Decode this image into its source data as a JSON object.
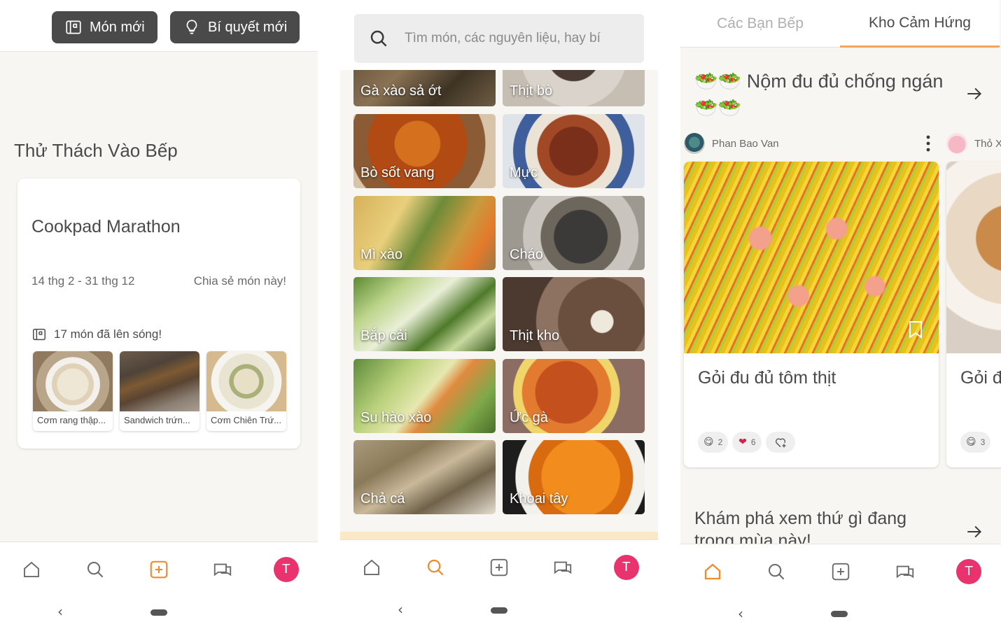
{
  "screen1": {
    "buttons": {
      "new_recipe": "Món mới",
      "new_tip": "Bí quyết mới"
    },
    "section_title": "Thử Thách Vào Bếp",
    "challenge": {
      "title": "Cookpad Marathon",
      "date_range": "14 thg 2 - 31 thg 12",
      "share_label": "Chia sẻ món này!",
      "count_label": "17 món đã lên sóng!",
      "thumbnails": [
        {
          "caption": "Cơm rang thập..."
        },
        {
          "caption": "Sandwich trứn..."
        },
        {
          "caption": "Cơm Chiên Trứ..."
        }
      ]
    }
  },
  "screen2": {
    "search": {
      "placeholder": "Tìm món, các nguyên liệu, hay bí"
    },
    "tiles": [
      {
        "label": "Gà xào sả ớt"
      },
      {
        "label": "Thịt bò"
      },
      {
        "label": "Bò sốt vang"
      },
      {
        "label": "Mực"
      },
      {
        "label": "Mì xào"
      },
      {
        "label": "Cháo"
      },
      {
        "label": "Bắp cải"
      },
      {
        "label": "Thịt kho"
      },
      {
        "label": "Su hào xào"
      },
      {
        "label": "Ức gà"
      },
      {
        "label": "Chả cá"
      },
      {
        "label": "Khoai tây"
      }
    ]
  },
  "screen3": {
    "tabs": {
      "friends": "Các Bạn Bếp",
      "inspiration": "Kho Cảm Hứng"
    },
    "heading": "🥗🥗 Nộm đu đủ chống ngán 🥗🥗",
    "author": "Phan Bao Van",
    "author2": "Thỏ X",
    "recipe": {
      "title": "Gỏi đu đủ tôm thịt",
      "reactions": [
        {
          "icon": "😋",
          "count": "2"
        },
        {
          "icon": "❤",
          "count": "6"
        }
      ]
    },
    "recipe2": {
      "title": "Gỏi đ",
      "reactions": [
        {
          "icon": "😋",
          "count": "3"
        }
      ]
    },
    "explore_heading": "Khám phá xem thứ gì đang trong mùa này!"
  },
  "nav": {
    "avatar_letter": "T"
  },
  "colors": {
    "accent": "#f5a45c",
    "avatar": "#e8336e",
    "nav_active": "#f08a2b"
  }
}
